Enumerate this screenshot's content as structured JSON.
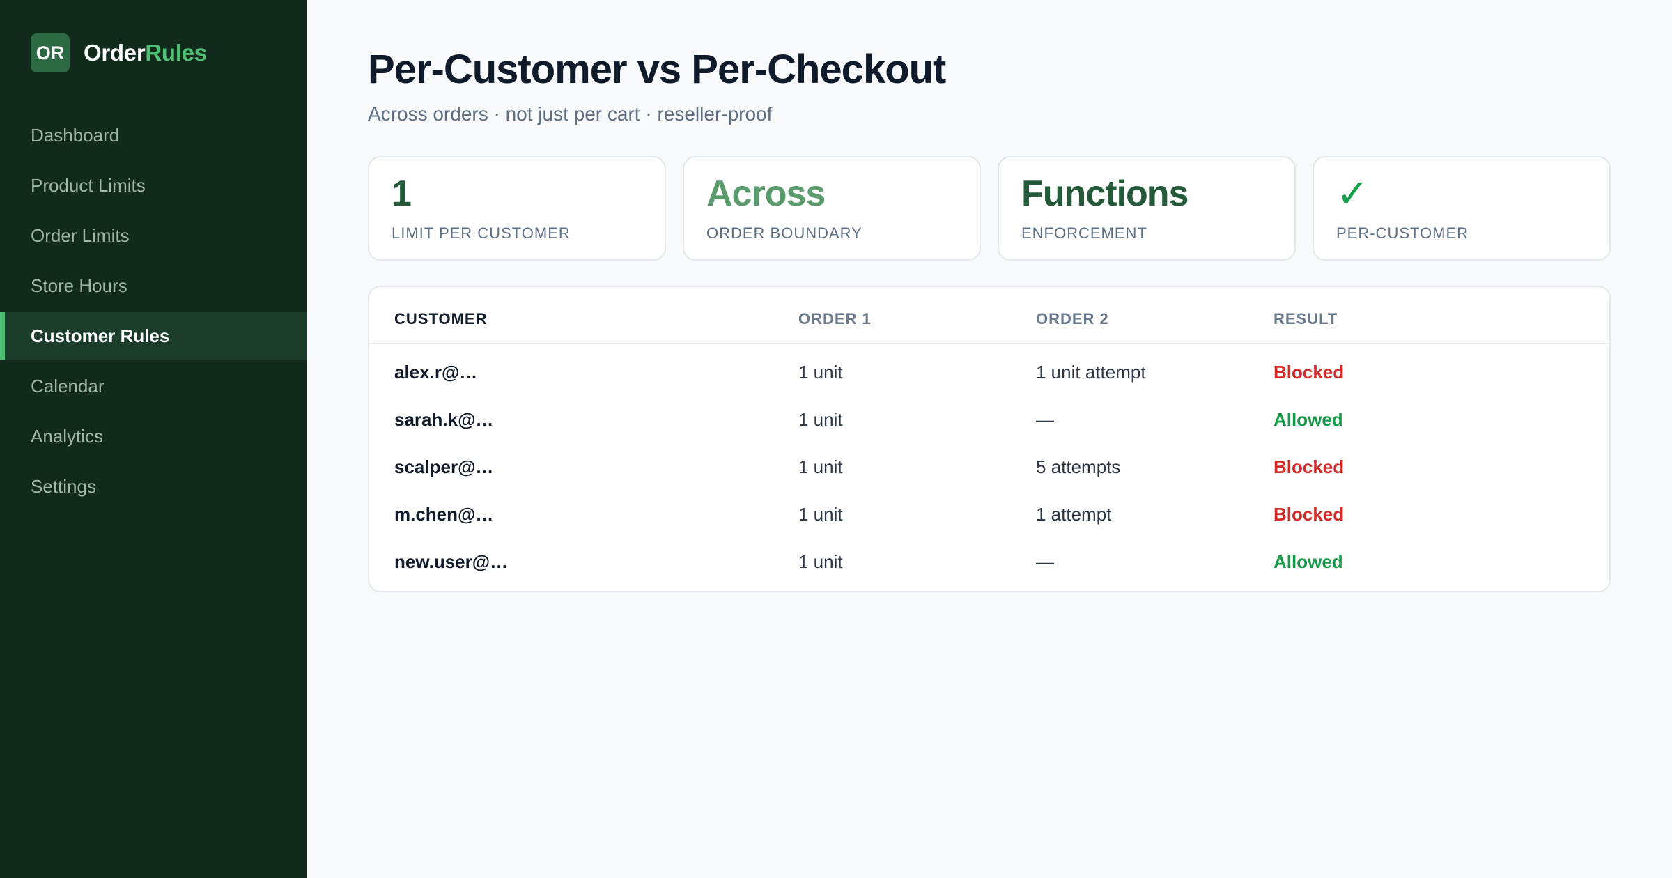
{
  "brand": {
    "badge": "OR",
    "name_part1": "Order",
    "name_part2": "Rules"
  },
  "nav": [
    {
      "label": "Dashboard",
      "active": false
    },
    {
      "label": "Product Limits",
      "active": false
    },
    {
      "label": "Order Limits",
      "active": false
    },
    {
      "label": "Store Hours",
      "active": false
    },
    {
      "label": "Customer Rules",
      "active": true
    },
    {
      "label": "Calendar",
      "active": false
    },
    {
      "label": "Analytics",
      "active": false
    },
    {
      "label": "Settings",
      "active": false
    }
  ],
  "header": {
    "title": "Per-Customer vs Per-Checkout",
    "subtitle": "Across orders · not just per cart · reseller-proof"
  },
  "stats": [
    {
      "value": "1",
      "label": "Limit per customer"
    },
    {
      "value": "Across",
      "label": "Order boundary"
    },
    {
      "value": "Functions",
      "label": "Enforcement"
    },
    {
      "value": "✓",
      "label": "Per-customer"
    }
  ],
  "table": {
    "columns": [
      "CUSTOMER",
      "ORDER 1",
      "ORDER 2",
      "RESULT"
    ],
    "rows": [
      {
        "customer": "alex.r@…",
        "order1": "1 unit",
        "order2": "1 unit attempt",
        "result": "Blocked"
      },
      {
        "customer": "sarah.k@…",
        "order1": "1 unit",
        "order2": "—",
        "result": "Allowed"
      },
      {
        "customer": "scalper@…",
        "order1": "1 unit",
        "order2": "5 attempts",
        "result": "Blocked"
      },
      {
        "customer": "m.chen@…",
        "order1": "1 unit",
        "order2": "1 attempt",
        "result": "Blocked"
      },
      {
        "customer": "new.user@…",
        "order1": "1 unit",
        "order2": "—",
        "result": "Allowed"
      }
    ]
  },
  "colors": {
    "sidebar_bg": "#112a1c",
    "accent": "#4fbf73",
    "blocked": "#d42a2a",
    "allowed": "#179a47"
  }
}
